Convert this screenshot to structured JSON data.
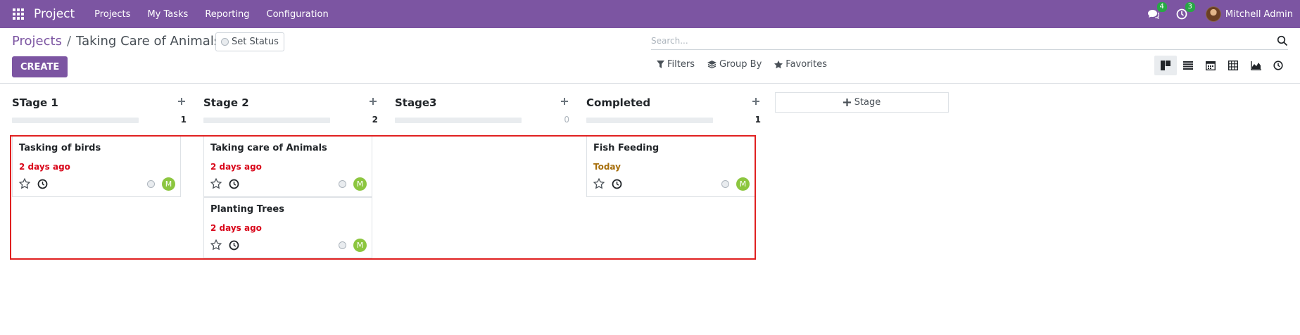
{
  "navbar": {
    "brand": "Project",
    "menu": [
      "Projects",
      "My Tasks",
      "Reporting",
      "Configuration"
    ],
    "messages_count": "4",
    "activities_count": "3",
    "user_name": "Mitchell Admin"
  },
  "control": {
    "breadcrumb_root": "Projects",
    "breadcrumb_sep": "/",
    "breadcrumb_current": "Taking Care of Animals",
    "set_status_label": "Set Status",
    "create_label": "CREATE",
    "search_placeholder": "Search...",
    "filters_label": "Filters",
    "groupby_label": "Group By",
    "favorites_label": "Favorites",
    "views": [
      "kanban-view-icon",
      "list-view-icon",
      "calendar-view-icon",
      "pivot-view-icon",
      "graph-view-icon",
      "activity-view-icon"
    ]
  },
  "kanban": {
    "add_stage_label": "Stage",
    "columns": [
      {
        "title": "STage 1",
        "count": "1",
        "cards": [
          {
            "title": "Tasking of birds",
            "date": "2 days ago",
            "date_color": "#d9061a",
            "assignee": "M"
          }
        ]
      },
      {
        "title": "Stage 2",
        "count": "2",
        "cards": [
          {
            "title": "Taking care of Animals",
            "date": "2 days ago",
            "date_color": "#d9061a",
            "assignee": "M"
          },
          {
            "title": "Planting Trees",
            "date": "2 days ago",
            "date_color": "#d9061a",
            "assignee": "M"
          }
        ]
      },
      {
        "title": "Stage3",
        "count": "0",
        "cards": []
      },
      {
        "title": "Completed",
        "count": "1",
        "cards": [
          {
            "title": "Fish Feeding",
            "date": "Today",
            "date_color": "#a76f0c",
            "assignee": "M"
          }
        ]
      }
    ]
  },
  "colors": {
    "brand": "#7c55a2",
    "overdue": "#d9061a",
    "today": "#a76f0c",
    "avatar": "#8cc63f",
    "highlight": "#e02020"
  }
}
